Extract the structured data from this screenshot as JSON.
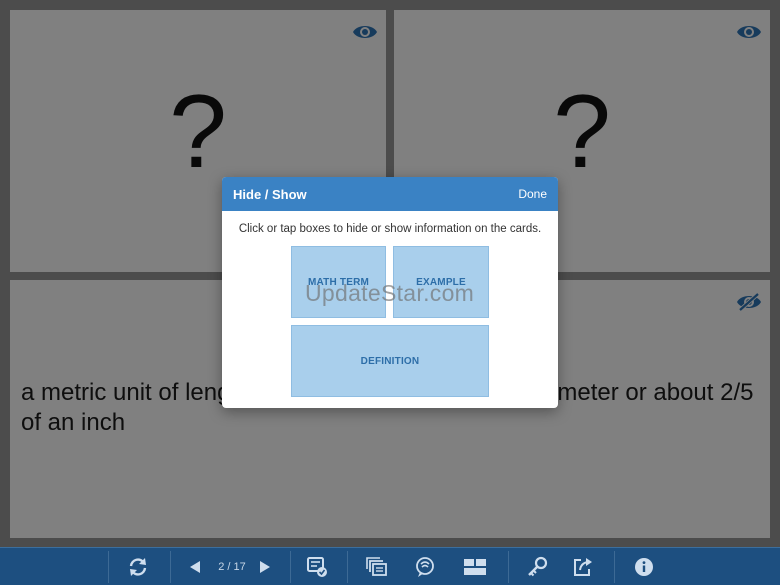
{
  "cards": {
    "term": {
      "placeholder": "?"
    },
    "example": {
      "placeholder": "?"
    },
    "definition": {
      "text": "a metric unit of length equal to one hundredth of a meter or about 2/5 of an inch"
    }
  },
  "dialog": {
    "title": "Hide / Show",
    "done_label": "Done",
    "instruction": "Click or tap boxes to hide or show information on the cards.",
    "boxes": {
      "term": "MATH TERM",
      "example": "EXAMPLE",
      "definition": "DEFINITION"
    }
  },
  "watermark": "UpdateStar.com",
  "toolbar": {
    "page_counter": "2 / 17",
    "icons": [
      "shuffle-icon",
      "prev-icon",
      "next-icon",
      "quiz-icon",
      "cards-icon",
      "audio-icon",
      "layout-icon",
      "key-icon",
      "share-icon",
      "info-icon"
    ]
  },
  "colors": {
    "header": "#3a82c4",
    "toolbar": "#1d4f80",
    "box": "#a9cfec",
    "eye": "#2b6ca8"
  }
}
